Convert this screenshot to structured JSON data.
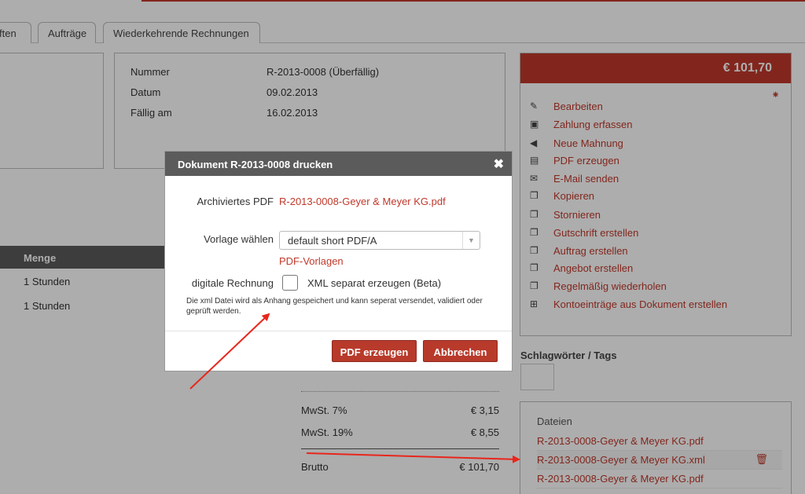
{
  "tabs": [
    "ften",
    "Aufträge",
    "Wiederkehrende Rechnungen"
  ],
  "invoice": {
    "rows": [
      {
        "label": "Nummer",
        "value": "R-2013-0008 (Überfällig)"
      },
      {
        "label": "Datum",
        "value": "09.02.2013"
      },
      {
        "label": "Fällig am",
        "value": "16.02.2013"
      }
    ]
  },
  "table": {
    "header": "Menge",
    "rows": [
      "1 Stunden",
      "1 Stunden"
    ]
  },
  "sidebar": {
    "amount": "€ 101,70",
    "actions": [
      {
        "icon": "edit-icon",
        "glyph": "✎",
        "label": "Bearbeiten"
      },
      {
        "icon": "money-icon",
        "glyph": "▣",
        "label": "Zahlung erfassen"
      },
      {
        "icon": "megaphone-icon",
        "glyph": "◀",
        "label": "Neue Mahnung"
      },
      {
        "icon": "pdf-icon",
        "glyph": "▤",
        "label": "PDF erzeugen"
      },
      {
        "icon": "envelope-icon",
        "glyph": "✉",
        "label": "E-Mail senden"
      },
      {
        "icon": "copy-icon",
        "glyph": "❐",
        "label": "Kopieren"
      },
      {
        "icon": "copy-icon",
        "glyph": "❐",
        "label": "Stornieren"
      },
      {
        "icon": "copy-icon",
        "glyph": "❐",
        "label": "Gutschrift erstellen"
      },
      {
        "icon": "copy-icon",
        "glyph": "❐",
        "label": "Auftrag erstellen"
      },
      {
        "icon": "copy-icon",
        "glyph": "❐",
        "label": "Angebot erstellen"
      },
      {
        "icon": "copy-icon",
        "glyph": "❐",
        "label": "Regelmäßig wiederholen"
      },
      {
        "icon": "plus-square-icon",
        "glyph": "⊞",
        "label": "Kontoeinträge aus Dokument erstellen"
      }
    ]
  },
  "tags": {
    "title": "Schlagwörter / Tags"
  },
  "files": {
    "title": "Dateien",
    "items": [
      "R-2013-0008-Geyer & Meyer KG.pdf",
      "R-2013-0008-Geyer & Meyer KG.xml",
      "R-2013-0008-Geyer & Meyer KG.pdf"
    ]
  },
  "totals": [
    {
      "label": "MwSt. 7%",
      "value": "€ 3,15"
    },
    {
      "label": "MwSt. 19%",
      "value": "€ 8,55"
    },
    {
      "label": "Brutto",
      "value": "€ 101,70"
    }
  ],
  "dialog": {
    "title": "Dokument R-2013-0008 drucken",
    "close": "✖",
    "archived_label": "Archiviertes PDF",
    "archived_link": "R-2013-0008-Geyer & Meyer KG.pdf",
    "template_label": "Vorlage wählen",
    "template_value": "default short PDF/A",
    "template_link": "PDF-Vorlagen",
    "einvoice_label": "digitale Rechnung",
    "xml_label": "XML separat erzeugen (Beta)",
    "note": "Die xml Datei wird als Anhang gespeichert und kann seperat versendet, validiert oder geprüft werden.",
    "btn_create": "PDF erzeugen",
    "btn_cancel": "Abbrechen"
  },
  "colors": {
    "accent": "#c0392b",
    "header": "#5b5b5b",
    "annotation": "#e8261c"
  }
}
